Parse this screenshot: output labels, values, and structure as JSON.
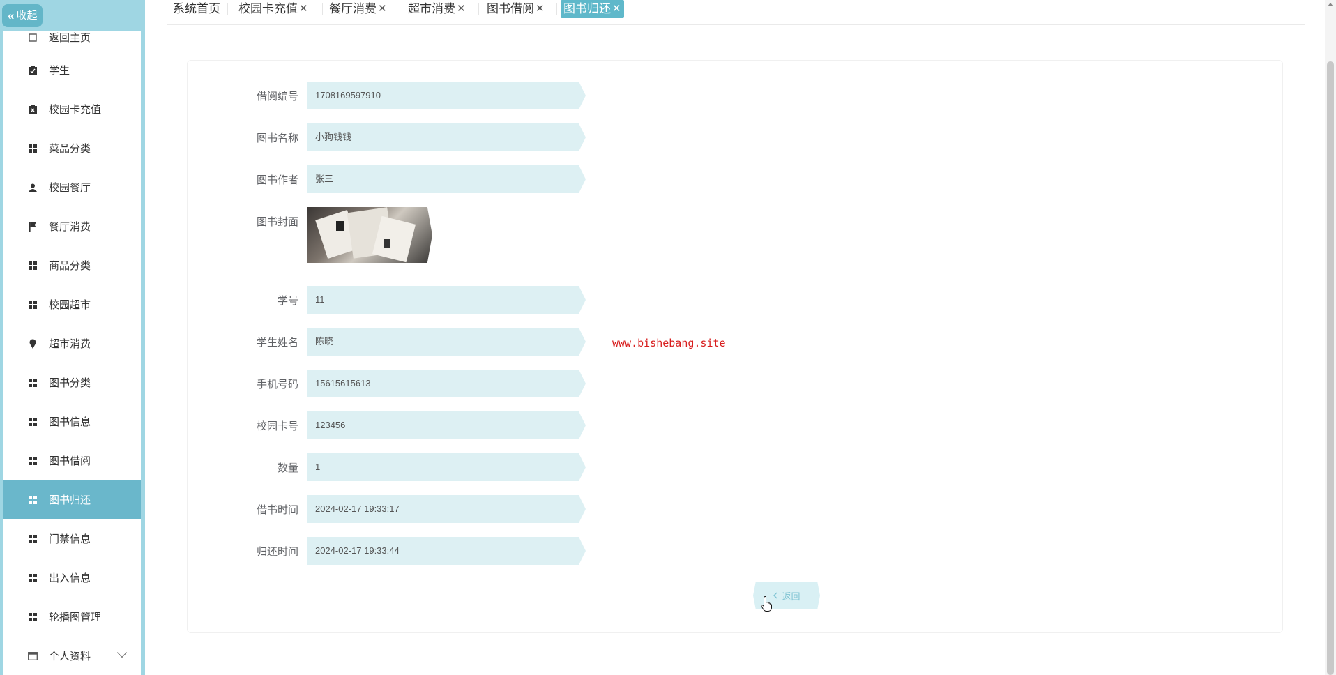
{
  "sidebar": {
    "collapse_label": "收起",
    "items": [
      {
        "label": "返回主页",
        "icon": "home-icon"
      },
      {
        "label": "学生",
        "icon": "clipboard-check-icon"
      },
      {
        "label": "校园卡充值",
        "icon": "clipboard-x-icon"
      },
      {
        "label": "菜品分类",
        "icon": "grid-icon"
      },
      {
        "label": "校园餐厅",
        "icon": "user-icon"
      },
      {
        "label": "餐厅消费",
        "icon": "flag-icon"
      },
      {
        "label": "商品分类",
        "icon": "grid-icon"
      },
      {
        "label": "校园超市",
        "icon": "grid-icon"
      },
      {
        "label": "超市消费",
        "icon": "pin-icon"
      },
      {
        "label": "图书分类",
        "icon": "grid-icon"
      },
      {
        "label": "图书信息",
        "icon": "grid-icon"
      },
      {
        "label": "图书借阅",
        "icon": "grid-icon"
      },
      {
        "label": "图书归还",
        "icon": "grid-icon",
        "active": true
      },
      {
        "label": "门禁信息",
        "icon": "grid-icon"
      },
      {
        "label": "出入信息",
        "icon": "grid-icon"
      },
      {
        "label": "轮播图管理",
        "icon": "grid-icon"
      },
      {
        "label": "个人资料",
        "icon": "profile-card-icon"
      }
    ]
  },
  "tabs": [
    {
      "label": "系统首页",
      "closable": false
    },
    {
      "label": "校园卡充值",
      "closable": true
    },
    {
      "label": "餐厅消费",
      "closable": true
    },
    {
      "label": "超市消费",
      "closable": true
    },
    {
      "label": "图书借阅",
      "closable": true
    },
    {
      "label": "图书归还",
      "closable": true,
      "active": true
    }
  ],
  "tab_close_glyph": "✕",
  "form": {
    "borrow_no": {
      "label": "借阅编号",
      "value": "1708169597910"
    },
    "book_name": {
      "label": "图书名称",
      "value": "小狗钱钱"
    },
    "book_author": {
      "label": "图书作者",
      "value": "张三"
    },
    "book_cover": {
      "label": "图书封面"
    },
    "student_no": {
      "label": "学号",
      "value": "11"
    },
    "student_name": {
      "label": "学生姓名",
      "value": "陈晓"
    },
    "phone": {
      "label": "手机号码",
      "value": "15615615613"
    },
    "card_no": {
      "label": "校园卡号",
      "value": "123456"
    },
    "quantity": {
      "label": "数量",
      "value": "1"
    },
    "borrow_time": {
      "label": "借书时间",
      "value": "2024-02-17 19:33:17"
    },
    "return_time": {
      "label": "归还时间",
      "value": "2024-02-17 19:33:44"
    }
  },
  "back_button": {
    "label": "返回",
    "icon": "chevron-left-icon"
  },
  "watermark": "www.bishebang.site",
  "colors": {
    "sidebar_bg": "#9fd6e3",
    "active_item": "#6ab7cb",
    "tab_active": "#5fb8ca",
    "field_bg": "#ddf0f3",
    "watermark": "#d81e1e"
  }
}
